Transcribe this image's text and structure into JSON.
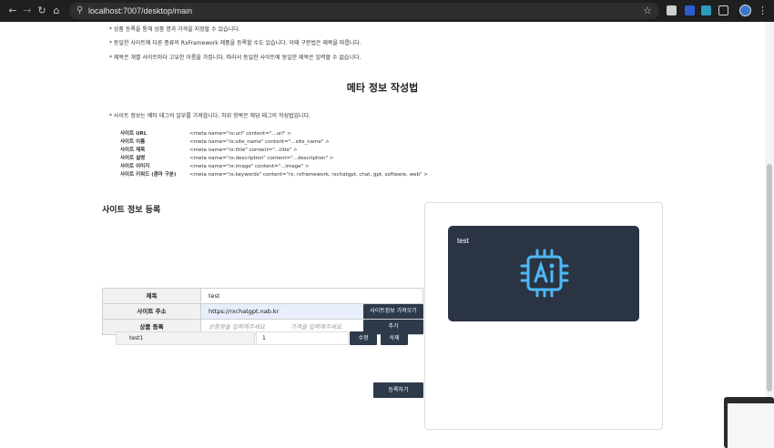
{
  "browser": {
    "url": "localhost:7007/desktop/main"
  },
  "notes": [
    "* 상품 등록을 통해 상품 명과 가격을 지정할 수 있습니다.",
    "* 동일한 사이트에 다른 종류의 RxFramework 제품을 등록할 수도 있습니다. 이때 구분법은 제목을 따릅니다.",
    "* 제목은 개별 사이트마다 고유한 이름을 가집니다. 따라서 동일한 사이트에 동일한 제목은 입력할 수 없습니다."
  ],
  "meta_section": {
    "title": "메타 정보 작성법",
    "intro": "* 사이트 정보는 메타 태그의 일부를 가져옵니다. 하위 항목은 해당 태그의 작성법입니다.",
    "rows": [
      {
        "key": "사이트 URL",
        "value": "<meta name=\"rx:url\" content=\"...url\" >"
      },
      {
        "key": "사이트 이름",
        "value": "<meta name=\"rx:site_name\" content=\"...site_name\" >"
      },
      {
        "key": "사이트 제목",
        "value": "<meta name=\"rx:title\" content=\"...title\" >"
      },
      {
        "key": "사이트 설명",
        "value": "<meta name=\"rx:description\" content=\"...description\" >"
      },
      {
        "key": "사이트 이미지",
        "value": "<meta name=\"rx:image\" content=\"...image\" >"
      },
      {
        "key": "사이트 키워드 (콤마 구분)",
        "value": "<meta name=\"rx:keywords\" content=\"rx, rxframework, rxchatgpt, chat, gpt, software, web\" >"
      }
    ]
  },
  "registration": {
    "title": "사이트 정보 등록",
    "title_label": "제목",
    "title_value": "test",
    "url_label": "사이트 주소",
    "url_value": "https://rxchatgpt.nab.kr",
    "fetch_button": "사이트정보 가져오기",
    "product_label": "상품 등록",
    "product_name_placeholder": "상품명을 입력해주세요",
    "product_price_placeholder": "가격을 입력해주세요.",
    "add_button": "추가",
    "products": [
      {
        "name": "test1",
        "price": "1",
        "edit_label": "수정",
        "delete_label": "삭제"
      }
    ],
    "submit_button": "등록하기"
  },
  "preview": {
    "card_title": "test",
    "icon": "ai-chip-icon",
    "icon_color": "#4fb7f5",
    "card_bg": "#2a3442"
  }
}
